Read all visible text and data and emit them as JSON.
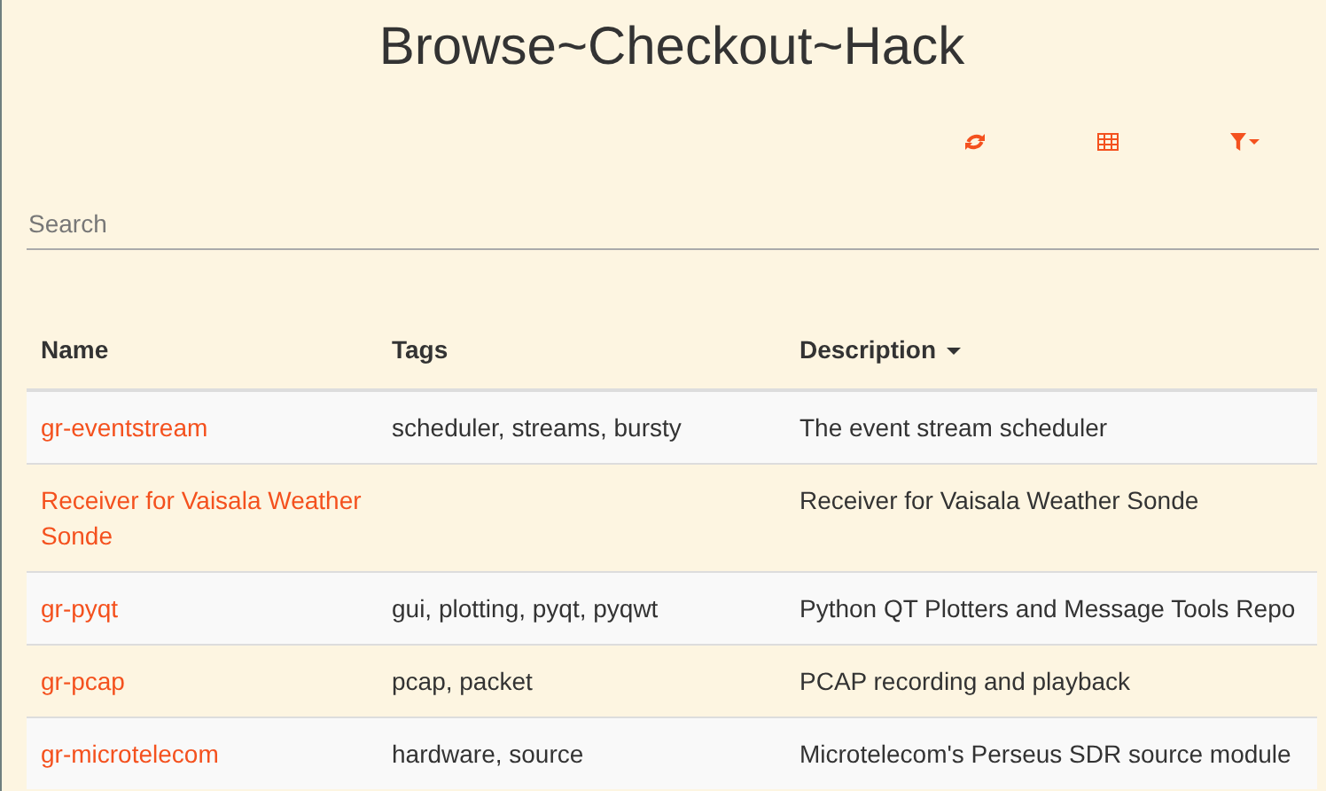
{
  "title": "Browse~Checkout~Hack",
  "toolbar": [
    {
      "kind": "refresh"
    },
    {
      "kind": "table"
    },
    {
      "kind": "filter"
    }
  ],
  "search": {
    "placeholder": "Search"
  },
  "table": {
    "columns": [
      {
        "label": "Name",
        "sorted": false
      },
      {
        "label": "Tags",
        "sorted": false
      },
      {
        "label": "Description",
        "sorted": true
      }
    ],
    "rows": [
      {
        "name": "gr-eventstream",
        "tags": "scheduler, streams, bursty",
        "description": "The event stream scheduler"
      },
      {
        "name": "Receiver for Vaisala Weather Sonde",
        "description": "Receiver for Vaisala Weather Sonde"
      },
      {
        "name": "gr-pyqt",
        "tags": "gui, plotting, pyqt, pyqwt",
        "description": "Python QT Plotters and Message Tools Repo"
      },
      {
        "name": "gr-pcap",
        "tags": "pcap, packet",
        "description": "PCAP recording and playback"
      },
      {
        "name": "gr-microtelecom",
        "tags": "hardware, source",
        "description": "Microtelecom's Perseus SDR source module"
      }
    ]
  }
}
